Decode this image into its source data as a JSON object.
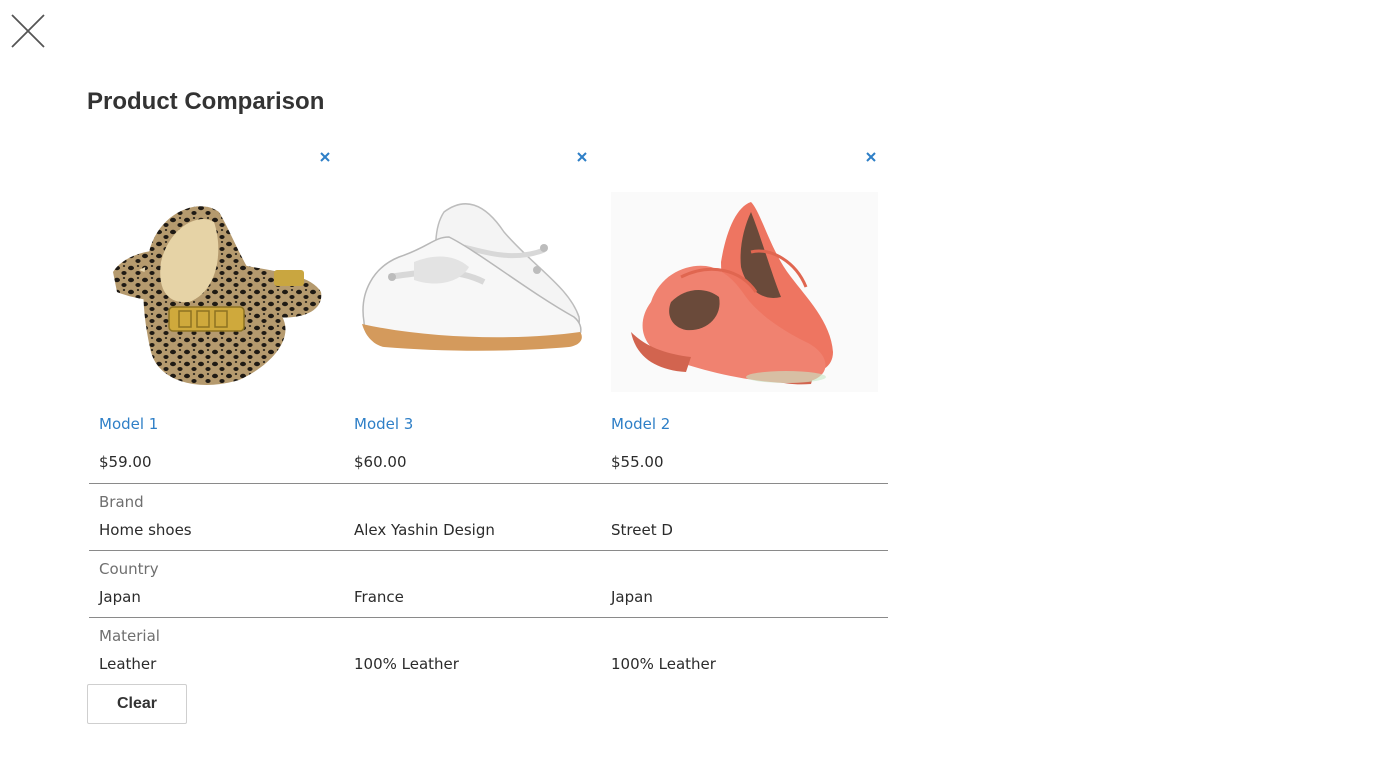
{
  "title": "Product Comparison",
  "accent_color": "#2e7fc7",
  "products": [
    {
      "name": "Model 1",
      "price": "$59.00",
      "image": "leopard-print-flats"
    },
    {
      "name": "Model 3",
      "price": "$60.00",
      "image": "white-mary-jane-shoes"
    },
    {
      "name": "Model 2",
      "price": "$55.00",
      "image": "coral-platform-heels"
    }
  ],
  "attributes": [
    {
      "label": "Brand",
      "values": [
        "Home shoes",
        "Alex Yashin Design",
        "Street D"
      ]
    },
    {
      "label": "Country",
      "values": [
        "Japan",
        "France",
        "Japan"
      ]
    },
    {
      "label": "Material",
      "values": [
        "Leather",
        "100% Leather",
        "100% Leather"
      ]
    }
  ],
  "clear_label": "Clear"
}
